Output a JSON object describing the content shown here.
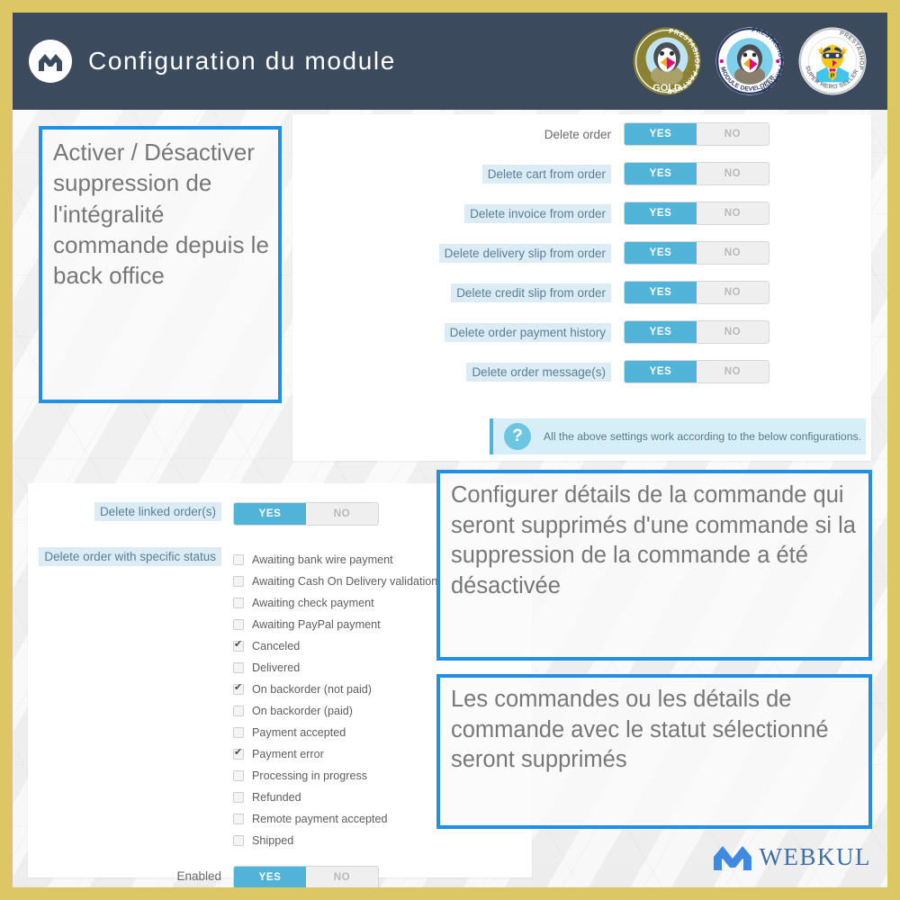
{
  "frame": {
    "border_color": "#ddc765"
  },
  "header": {
    "title": "Configuration du module",
    "logo_icon": "webkul-w-logo-icon",
    "background": "#3b4a5c",
    "badges": [
      {
        "name": "prestashop-partner-gold-badge",
        "line1": "PRESTASHOP PARTNER",
        "line2": "GOLD",
        "color": "#8a8232"
      },
      {
        "name": "prestashop-partner-module-developer-badge",
        "line1": "PRESTASHOP PARTNER",
        "line2": "MODULE DEVELOPER",
        "color": "#2b3a66"
      },
      {
        "name": "prestashop-super-hero-seller-badge",
        "line1": "PRESTASHOP",
        "line2": "SUPER HERO SELLER",
        "color": "#b9bcc0"
      }
    ]
  },
  "settings_card": {
    "toggle_yes": "YES",
    "toggle_no": "NO",
    "accent": "#52b3d9",
    "rows": [
      {
        "label": "Delete order",
        "value": "YES",
        "highlight": false
      },
      {
        "label": "Delete cart from order",
        "value": "YES",
        "highlight": true
      },
      {
        "label": "Delete invoice from order",
        "value": "YES",
        "highlight": true
      },
      {
        "label": "Delete delivery slip from order",
        "value": "YES",
        "highlight": true
      },
      {
        "label": "Delete credit slip from order",
        "value": "YES",
        "highlight": true
      },
      {
        "label": "Delete order payment history",
        "value": "YES",
        "highlight": true
      },
      {
        "label": "Delete order message(s)",
        "value": "YES",
        "highlight": true
      }
    ],
    "info_banner": {
      "icon": "question-mark-icon",
      "text": "All the above settings work according to the below configurations.",
      "background": "#d6eef7"
    }
  },
  "status_card": {
    "linked_orders": {
      "label": "Delete linked order(s)",
      "value": "YES"
    },
    "specific_status": {
      "label": "Delete order with specific status"
    },
    "enabled": {
      "label": "Enabled",
      "value": "YES"
    },
    "toggle_yes": "YES",
    "toggle_no": "NO",
    "statuses": [
      {
        "label": "Awaiting bank wire payment",
        "checked": false
      },
      {
        "label": "Awaiting Cash On Delivery validation",
        "checked": false
      },
      {
        "label": "Awaiting check payment",
        "checked": false
      },
      {
        "label": "Awaiting PayPal payment",
        "checked": false
      },
      {
        "label": "Canceled",
        "checked": true
      },
      {
        "label": "Delivered",
        "checked": false
      },
      {
        "label": "On backorder (not paid)",
        "checked": true
      },
      {
        "label": "On backorder (paid)",
        "checked": false
      },
      {
        "label": "Payment accepted",
        "checked": false
      },
      {
        "label": "Payment error",
        "checked": true
      },
      {
        "label": "Processing in progress",
        "checked": false
      },
      {
        "label": "Refunded",
        "checked": false
      },
      {
        "label": "Remote payment accepted",
        "checked": false
      },
      {
        "label": "Shipped",
        "checked": false
      }
    ]
  },
  "callouts": {
    "left": "Activer / Désactiver suppression de l'intégralité commande depuis le back office",
    "middle": "Configurer détails de la commande qui seront supprimés d'une commande si la suppression de la commande a été désactivée",
    "lower": "Les commandes ou les détails de commande avec le statut sélectionné seront supprimés",
    "border_color": "#1e90e8"
  },
  "footer": {
    "brand": "WEBKUL",
    "logo_icon": "webkul-logo-icon",
    "brand_color": "#3f6fa8"
  }
}
